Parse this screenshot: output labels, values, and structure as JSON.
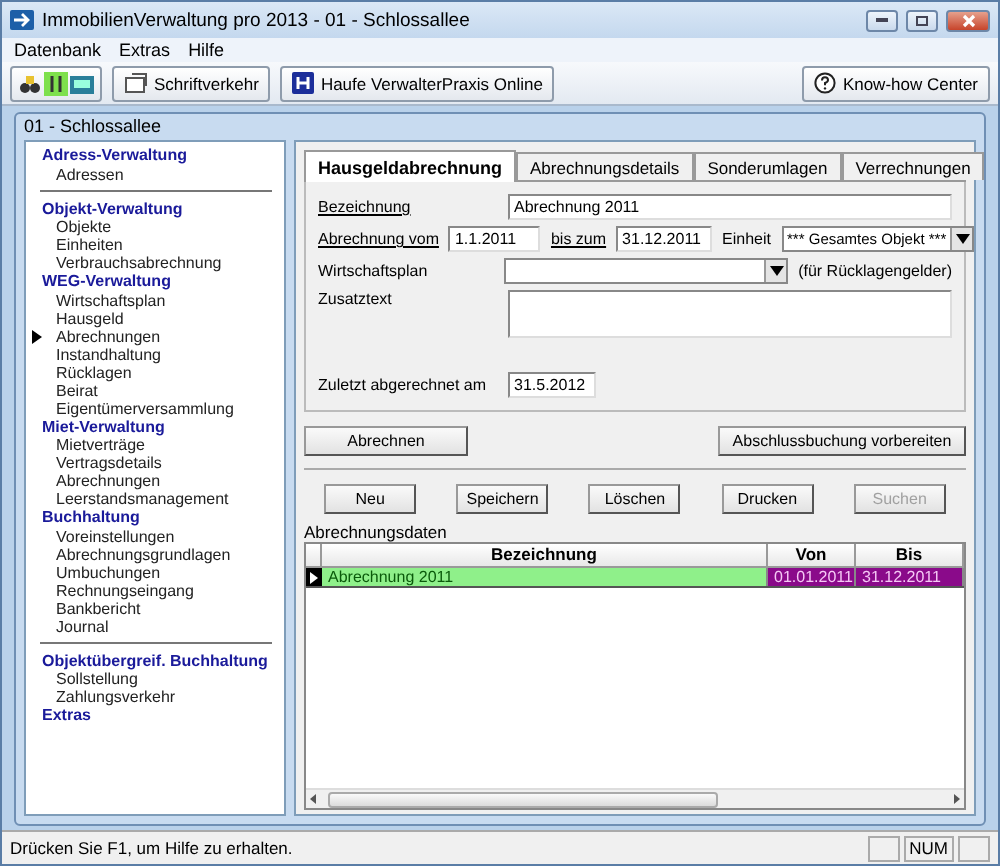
{
  "window": {
    "title": "ImmobilienVerwaltung pro 2013 - 01 - Schlossallee"
  },
  "menu": [
    "Datenbank",
    "Extras",
    "Hilfe"
  ],
  "toolbar": {
    "buttons": [
      "Schriftverkehr",
      "Haufe VerwalterPraxis Online"
    ],
    "help_button": "Know-how Center"
  },
  "document": {
    "title": "01 - Schlossallee"
  },
  "sidebar": {
    "sections": [
      {
        "heading": "Adress-Verwaltung",
        "divider_after": true,
        "items": [
          {
            "label": "Adressen",
            "selected": false
          }
        ]
      },
      {
        "heading": "Objekt-Verwaltung",
        "divider_after": false,
        "items": [
          {
            "label": "Objekte",
            "selected": false
          },
          {
            "label": "Einheiten",
            "selected": false
          },
          {
            "label": "Verbrauchsabrechnung",
            "selected": false
          }
        ]
      },
      {
        "heading": "WEG-Verwaltung",
        "divider_after": false,
        "items": [
          {
            "label": "Wirtschaftsplan",
            "selected": false
          },
          {
            "label": "Hausgeld",
            "selected": false
          },
          {
            "label": "Abrechnungen",
            "selected": true
          },
          {
            "label": "Instandhaltung",
            "selected": false
          },
          {
            "label": "Rücklagen",
            "selected": false
          },
          {
            "label": "Beirat",
            "selected": false
          },
          {
            "label": "Eigentümerversammlung",
            "selected": false
          }
        ]
      },
      {
        "heading": "Miet-Verwaltung",
        "divider_after": false,
        "items": [
          {
            "label": "Mietverträge",
            "selected": false
          },
          {
            "label": "Vertragsdetails",
            "selected": false
          },
          {
            "label": "Abrechnungen",
            "selected": false
          },
          {
            "label": "Leerstandsmanagement",
            "selected": false
          }
        ]
      },
      {
        "heading": "Buchhaltung",
        "divider_after": true,
        "items": [
          {
            "label": "Voreinstellungen",
            "selected": false
          },
          {
            "label": "Abrechnungsgrundlagen",
            "selected": false
          },
          {
            "label": "Umbuchungen",
            "selected": false
          },
          {
            "label": "Rechnungseingang",
            "selected": false
          },
          {
            "label": "Bankbericht",
            "selected": false
          },
          {
            "label": "Journal",
            "selected": false
          }
        ]
      },
      {
        "heading": "Objektübergreif. Buchhaltung",
        "divider_after": false,
        "items": [
          {
            "label": "Sollstellung",
            "selected": false
          },
          {
            "label": "Zahlungsverkehr",
            "selected": false
          }
        ]
      },
      {
        "heading": "Extras",
        "divider_after": false
      }
    ]
  },
  "tabs": [
    {
      "label": "Hausgeldabrechnung",
      "selected": true
    },
    {
      "label": "Abrechnungsdetails",
      "selected": false
    },
    {
      "label": "Sonderumlagen",
      "selected": false
    },
    {
      "label": "Verrechnungen",
      "selected": false
    }
  ],
  "form": {
    "name": {
      "label": "Bezeichnung",
      "value": "Abrechnung 2011"
    },
    "period": {
      "label": "Abrechnung vom",
      "from": "1.1.2011",
      "to_label": "bis zum",
      "to": "31.12.2011",
      "unit_label": "Einheit",
      "unit": "*** Gesamtes Objekt ***"
    },
    "plan": {
      "label": "Wirtschaftsplan",
      "note": "(für Rücklagengelder)"
    },
    "extra_text": {
      "label": "Zusatztext"
    },
    "last_settled": {
      "label": "Zuletzt abgerechnet am",
      "value": "31.5.2012"
    }
  },
  "actions": [
    "Abrechnen",
    "Abschlussbuchung vorbereiten"
  ],
  "record_buttons": [
    {
      "label": "Neu",
      "disabled": false
    },
    {
      "label": "Speichern",
      "disabled": false
    },
    {
      "label": "Löschen",
      "disabled": false
    },
    {
      "label": "Drucken",
      "disabled": false
    },
    {
      "label": "Suchen",
      "disabled": true
    }
  ],
  "grid": {
    "caption": "Abrechnungsdaten",
    "columns": [
      "Bezeichnung",
      "Von",
      "Bis"
    ],
    "rows": [
      {
        "cells": [
          "Abrechnung 2011",
          "01.01.2011",
          "31.12.2011"
        ],
        "selected": true
      }
    ]
  },
  "status_bar": {
    "text": "Drücken Sie F1, um Hilfe zu erhalten.",
    "indicators": [
      "NUM"
    ]
  }
}
